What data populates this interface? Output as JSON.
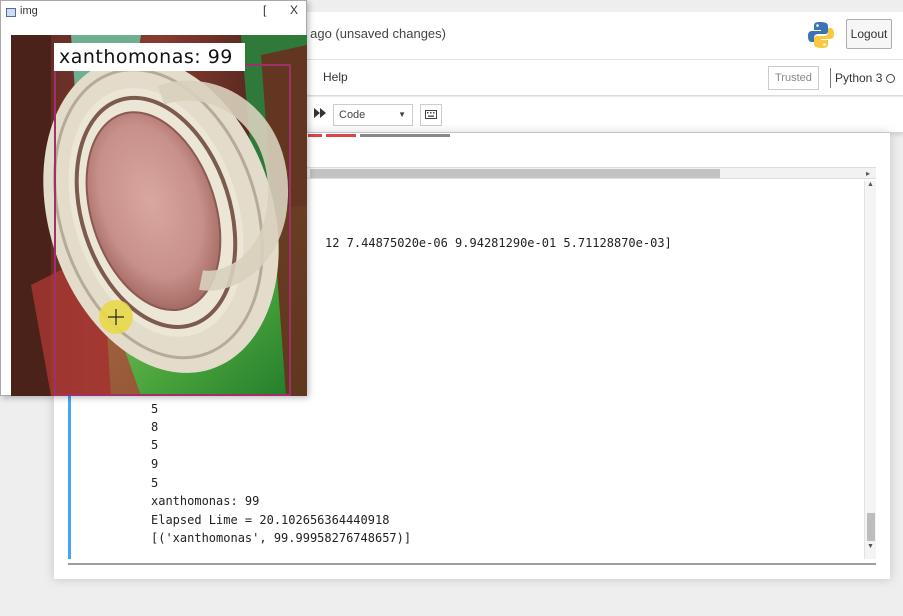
{
  "header": {
    "save_status": "s ago  (unsaved changes)",
    "logout_label": "Logout"
  },
  "menubar": {
    "help_label": "Help",
    "trusted_label": "Trusted",
    "kernel_label": "Python 3"
  },
  "toolbar": {
    "run_all_icon": "fast-forward-icon",
    "cell_type": "Code",
    "keyboard_icon": "keyboard-icon"
  },
  "notebook": {
    "prediction_array": "12 7.44875020e-06 9.94281290e-01 5.71128870e-03]",
    "output_lines": [
      "5",
      "8",
      "5",
      "9",
      "5",
      "xanthomonas: 99",
      "Elapsed Lime = 20.102656364440918",
      "[('xanthomonas', 99.99958276748657)]"
    ]
  },
  "image_window": {
    "title": "img",
    "minimize_glyph": "[",
    "close_glyph": "X",
    "label": "xanthomonas: 99"
  },
  "colors": {
    "cell_selected_bar": "#42a5f5",
    "bbox": "#a0306a",
    "label_bg": "#ffffff"
  }
}
